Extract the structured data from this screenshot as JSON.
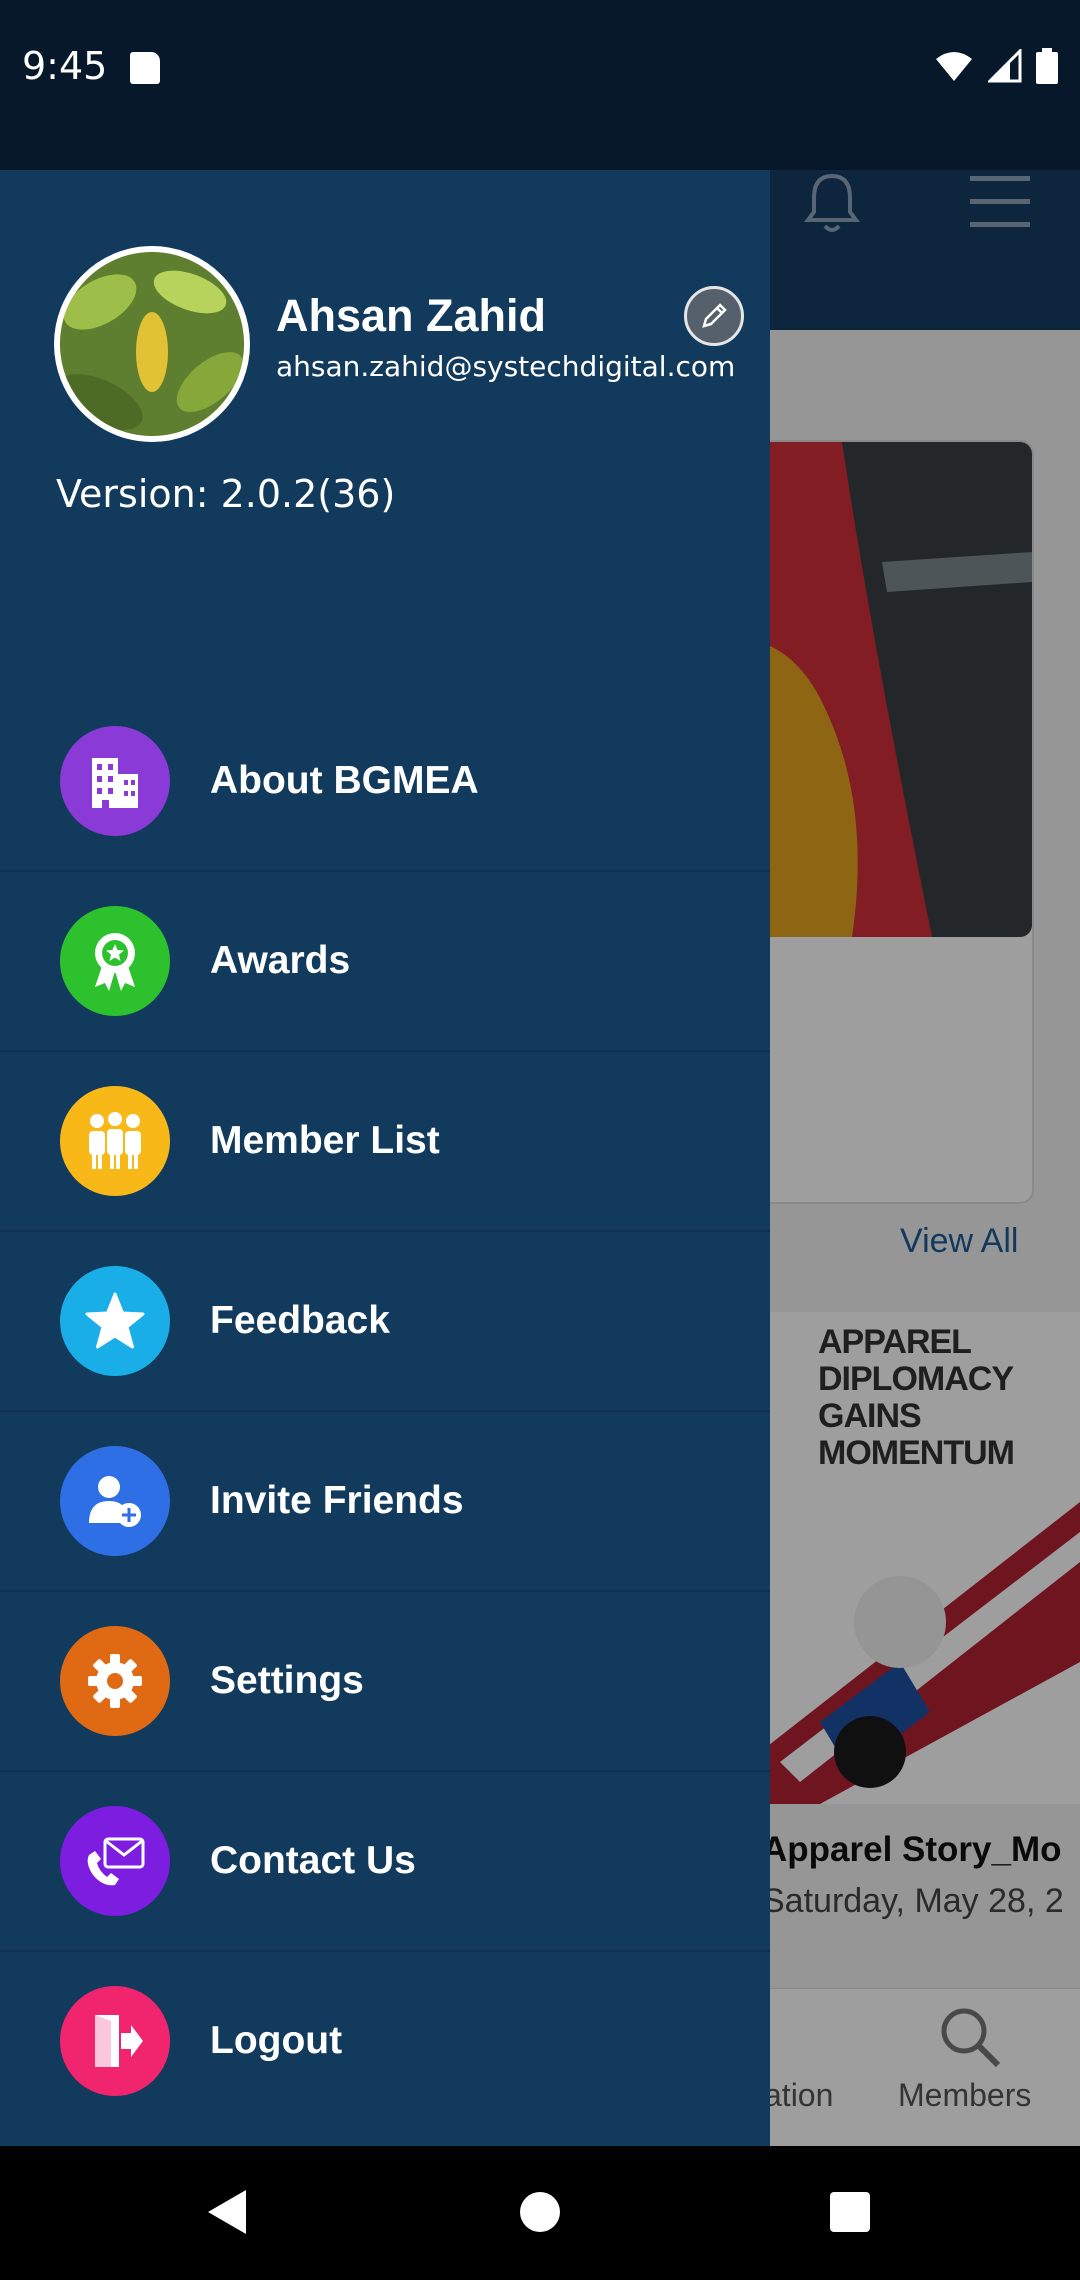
{
  "status_bar": {
    "time": "9:45"
  },
  "background": {
    "view_all": "View All",
    "story_headline": [
      "APPAREL",
      "DIPLOMACY",
      "GAINS",
      "MOMENTUM"
    ],
    "story_title": "Apparel Story_Mo",
    "story_date": "Saturday, May 28, 2",
    "nav_label_1": "ation",
    "nav_label_2": "Members"
  },
  "drawer": {
    "user": {
      "name": "Ahsan Zahid",
      "email": "ahsan.zahid@systechdigital.com"
    },
    "version": "Version: 2.0.2(36)",
    "items": [
      {
        "label": "About BGMEA",
        "icon": "building-icon",
        "color": "#8a3ad6"
      },
      {
        "label": "Awards",
        "icon": "award-badge-icon",
        "color": "#2ec12e"
      },
      {
        "label": "Member List",
        "icon": "group-icon",
        "color": "#f7b818"
      },
      {
        "label": "Feedback",
        "icon": "star-icon",
        "color": "#1aaee8"
      },
      {
        "label": "Invite Friends",
        "icon": "add-user-icon",
        "color": "#2f6fe6"
      },
      {
        "label": "Settings",
        "icon": "gear-icon",
        "color": "#e06a14"
      },
      {
        "label": "Contact Us",
        "icon": "phone-mail-icon",
        "color": "#7c1de0"
      },
      {
        "label": "Logout",
        "icon": "logout-icon",
        "color": "#f0256e"
      }
    ]
  }
}
